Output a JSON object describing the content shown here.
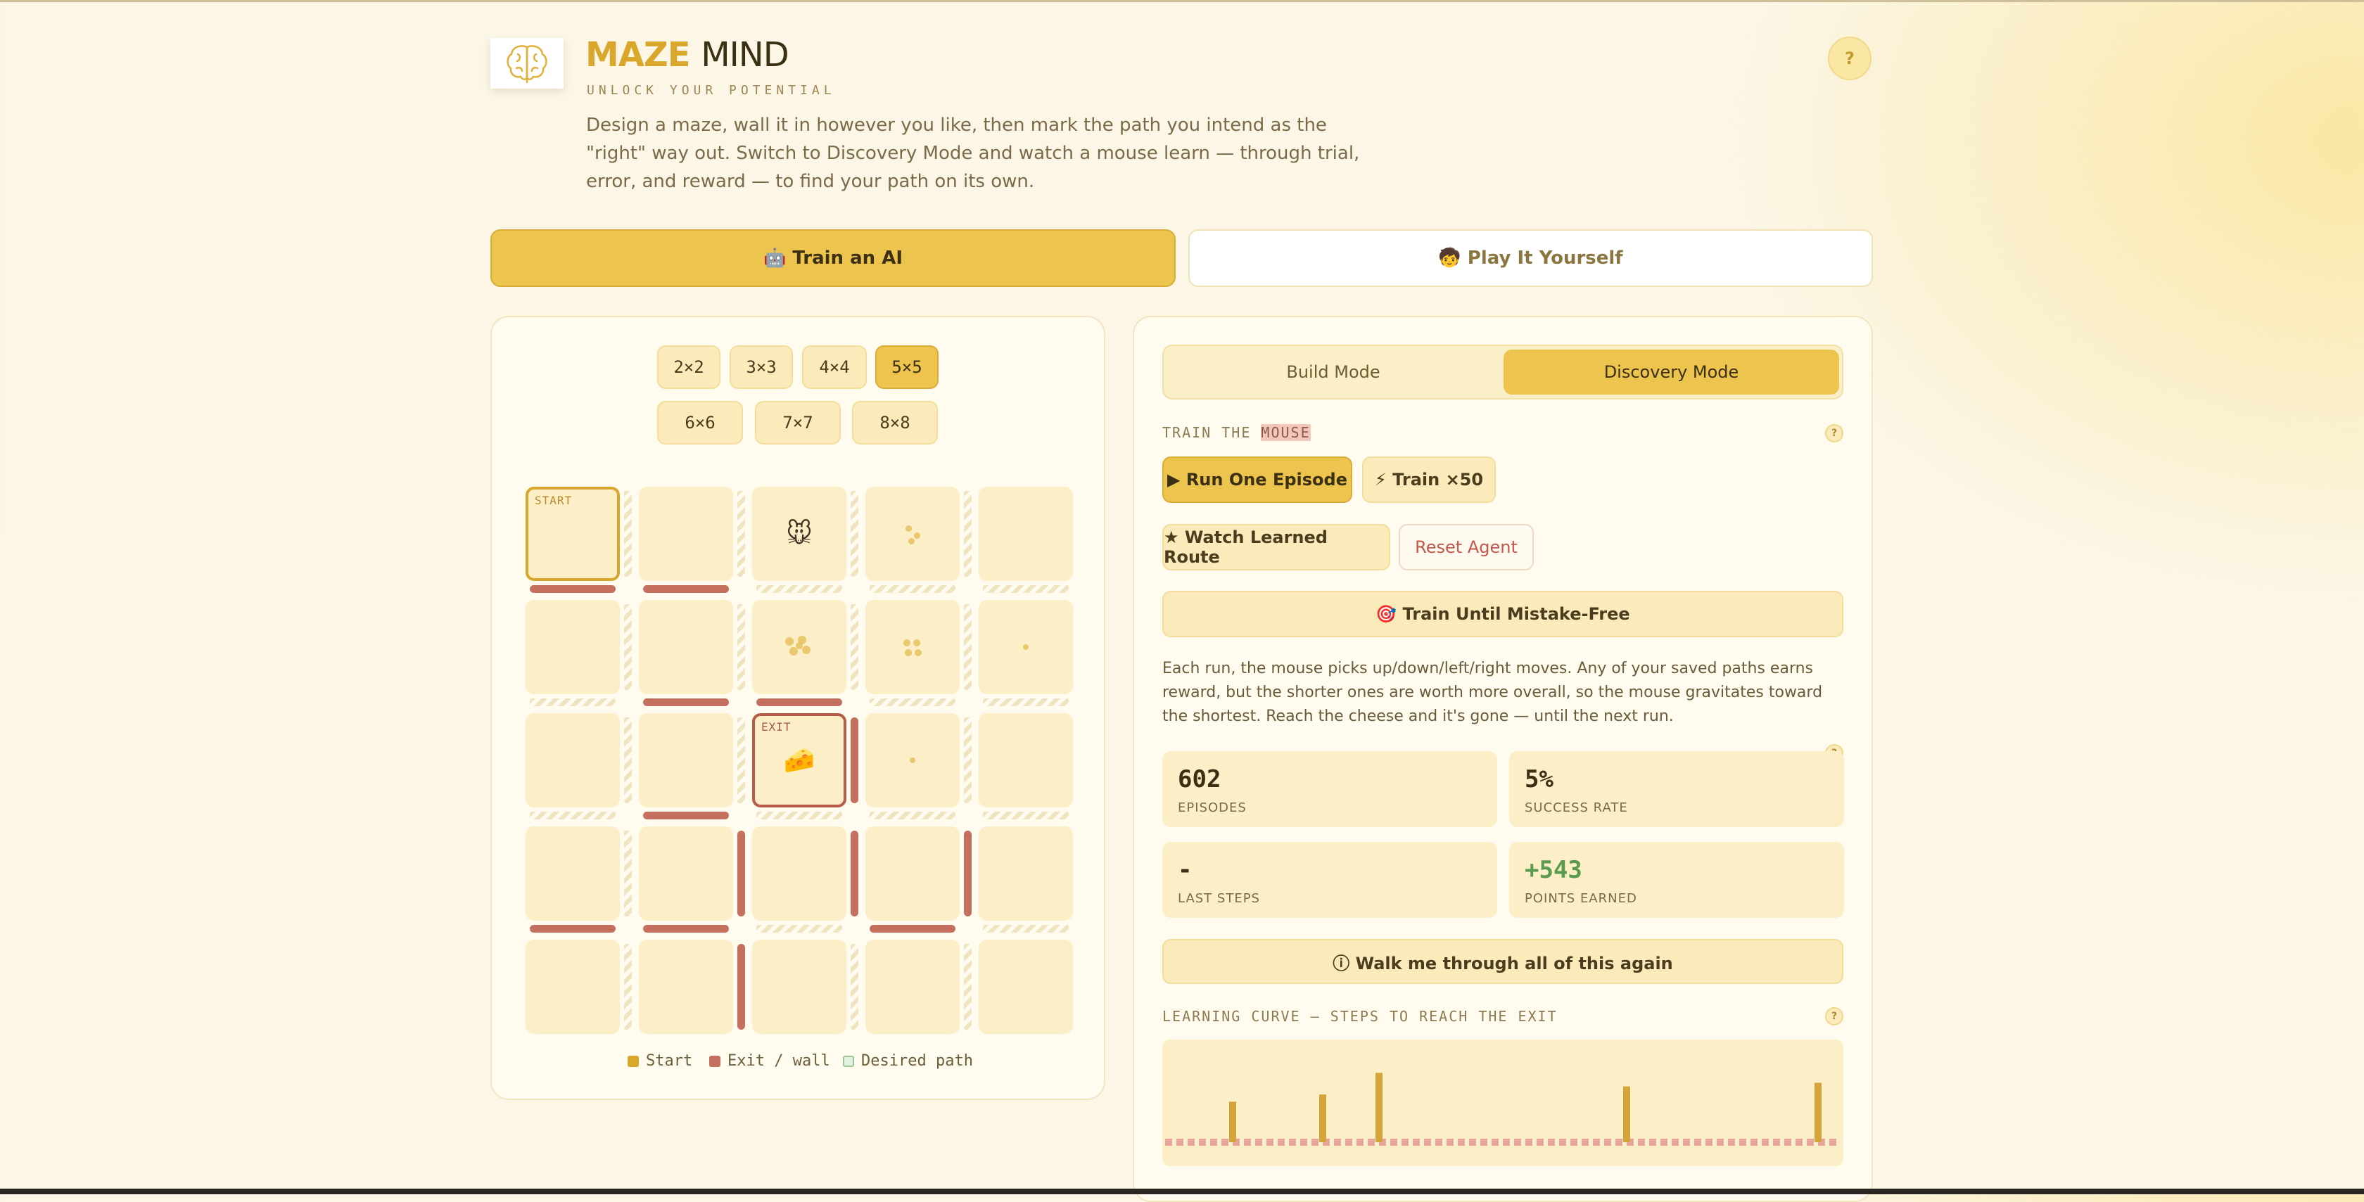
{
  "header": {
    "title_part1": "MAZE",
    "title_part2": "MIND",
    "subtitle": "UNLOCK YOUR POTENTIAL",
    "intro": "Design a maze, wall it in however you like, then mark the path you intend as the \"right\" way out. Switch to Discovery Mode and watch a mouse learn — through trial, error, and reward — to find your path on its own.",
    "help_label": "?",
    "logo_icon": "brain-icon"
  },
  "main_tabs": [
    {
      "label": "🤖 Train an AI",
      "active": true
    },
    {
      "label": "🧒 Play It Yourself",
      "active": false
    }
  ],
  "maze": {
    "size_options": [
      "2×2",
      "3×3",
      "4×4",
      "5×5",
      "6×6",
      "7×7",
      "8×8"
    ],
    "selected_size": "5×5",
    "rows": 5,
    "cols": 5,
    "start_label": "START",
    "exit_label": "EXIT",
    "mouse_icon": "🐭",
    "cheese_icon": "🧀",
    "legend": {
      "start": "Start",
      "exit_wall": "Exit / wall",
      "desired_path": "Desired path"
    }
  },
  "right_panel": {
    "modes": {
      "build": "Build Mode",
      "discovery": "Discovery Mode",
      "selected": "discovery"
    },
    "section_train_prefix": "TRAIN THE",
    "section_train_highlight": "MOUSE",
    "buttons": {
      "run_one": "▶ Run One Episode",
      "train_50": "⚡ Train ×50",
      "watch_route": "★ Watch Learned Route",
      "reset_agent": "Reset Agent",
      "train_until": "🎯 Train Until Mistake-Free",
      "walkthrough": "ⓘ Walk me through all of this again"
    },
    "explanation": "Each run, the mouse picks up/down/left/right moves. Any of your saved paths earns reward, but the shorter ones are worth more overall, so the mouse gravitates toward the shortest. Reach the cheese and it's gone — until the next run.",
    "stats": [
      {
        "value": "602",
        "label": "EPISODES"
      },
      {
        "value": "5%",
        "label": "SUCCESS RATE"
      },
      {
        "value": "-",
        "label": "LAST STEPS"
      },
      {
        "value": "+543",
        "label": "POINTS EARNED"
      }
    ],
    "help_label": "?",
    "chart_title": "LEARNING CURVE — STEPS TO REACH THE EXIT"
  },
  "chart_data": {
    "type": "bar",
    "title": "LEARNING CURVE — STEPS TO REACH THE EXIT",
    "x": [
      6,
      14,
      19,
      41,
      58
    ],
    "values": [
      0.45,
      0.53,
      0.77,
      0.62,
      0.66
    ],
    "value_unit": "fraction of chart height",
    "x_range": [
      0,
      60
    ],
    "baseline": "dashed",
    "colors": {
      "bar": "#d7a43a",
      "baseline": "#e5a59a"
    }
  },
  "colors": {
    "accent": "#ecc44e",
    "wall": "#c5705f",
    "start": "#d9a72c",
    "exit": "#b85c4a",
    "positive": "#5a9a4e"
  }
}
